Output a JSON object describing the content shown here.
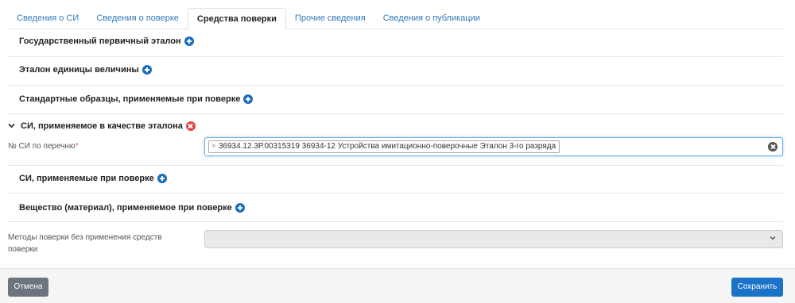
{
  "tabs": [
    {
      "label": "Сведения о СИ",
      "active": false
    },
    {
      "label": "Сведения о поверке",
      "active": false
    },
    {
      "label": "Средства поверки",
      "active": true
    },
    {
      "label": "Прочие сведения",
      "active": false
    },
    {
      "label": "Сведения о публикации",
      "active": false
    }
  ],
  "sections": {
    "state_primary_standard": "Государственный первичный эталон",
    "unit_standard": "Эталон единицы величины",
    "reference_samples": "Стандартные образцы, применяемые при поверке",
    "si_as_standard": "СИ, применяемое в качестве эталона",
    "si_used": "СИ, применяемые при поверке",
    "substance": "Вещество (материал), применяемое при поверке"
  },
  "si_field": {
    "label": "№ СИ по перечню",
    "required_mark": "*",
    "chip_remove": "×",
    "selected_value": "36934.12.3Р.00315319 36934-12 Устройства имитационно-поверочные Эталон 3-го разряда"
  },
  "methods_field": {
    "label": "Методы поверки без применения средств поверки",
    "value": ""
  },
  "icons": {
    "add": "plus-circle",
    "remove": "x-circle",
    "expanded": "chevron-down",
    "clear": "x-circle-dark",
    "dropdown": "chevron-down"
  },
  "colors": {
    "link": "#337ab7",
    "add_icon": "#1a6ebc",
    "remove_icon": "#e04848",
    "save_button": "#1a73c7",
    "cancel_button": "#6c757d"
  },
  "footer": {
    "cancel_label": "Отмена",
    "save_label": "Сохранить"
  }
}
